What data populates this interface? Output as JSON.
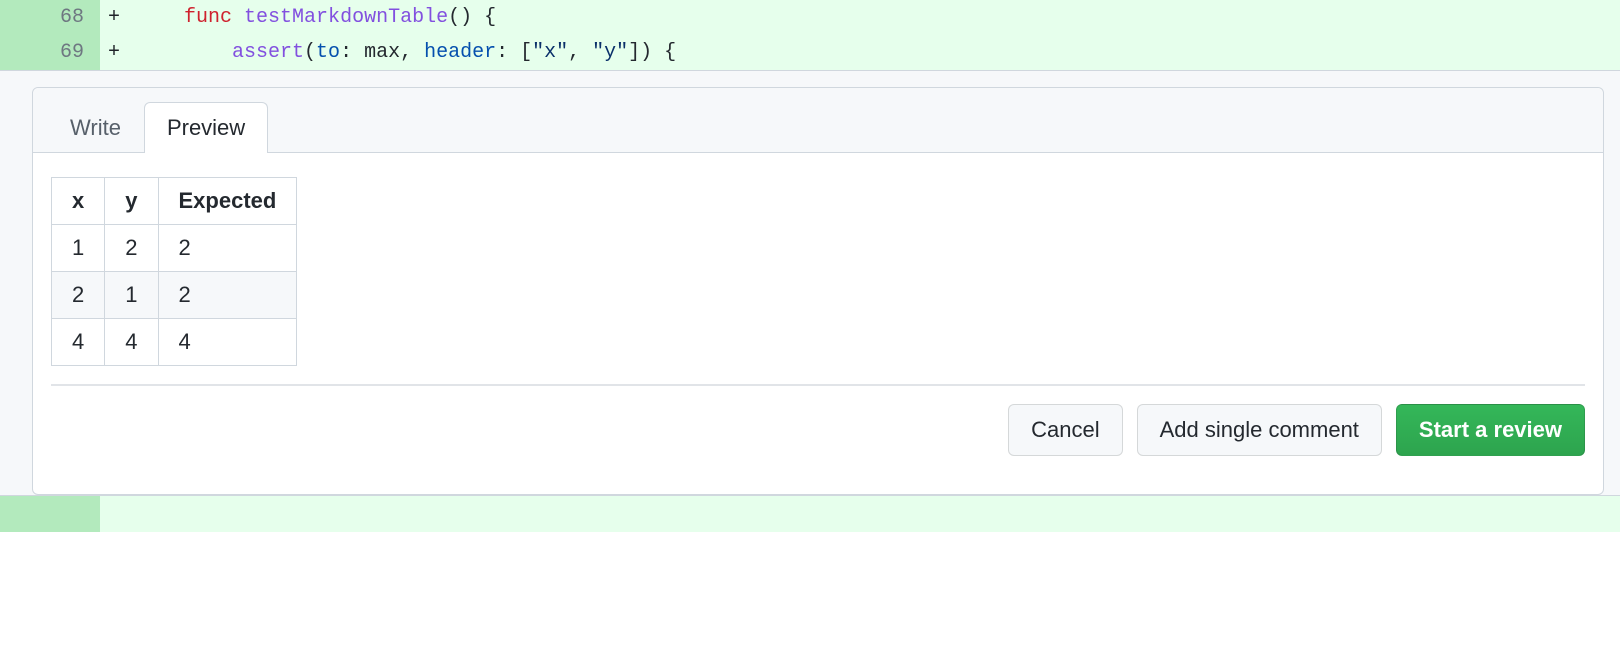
{
  "diff": {
    "lines": [
      {
        "num": "68",
        "marker": "+",
        "segments": [
          {
            "cls": "plain",
            "text": "    "
          },
          {
            "cls": "kw-func",
            "text": "func"
          },
          {
            "cls": "plain",
            "text": " "
          },
          {
            "cls": "kw-name",
            "text": "testMarkdownTable"
          },
          {
            "cls": "plain",
            "text": "() {"
          }
        ]
      },
      {
        "num": "69",
        "marker": "+",
        "segments": [
          {
            "cls": "plain",
            "text": "        "
          },
          {
            "cls": "kw-call",
            "text": "assert"
          },
          {
            "cls": "plain",
            "text": "("
          },
          {
            "cls": "kw-param",
            "text": "to"
          },
          {
            "cls": "plain",
            "text": ": max, "
          },
          {
            "cls": "kw-param",
            "text": "header"
          },
          {
            "cls": "plain",
            "text": ": ["
          },
          {
            "cls": "kw-string",
            "text": "\"x\""
          },
          {
            "cls": "plain",
            "text": ", "
          },
          {
            "cls": "kw-string",
            "text": "\"y\""
          },
          {
            "cls": "plain",
            "text": "]) {"
          }
        ]
      }
    ]
  },
  "tabs": {
    "write": "Write",
    "preview": "Preview"
  },
  "table": {
    "headers": [
      "x",
      "y",
      "Expected"
    ],
    "rows": [
      [
        "1",
        "2",
        "2"
      ],
      [
        "2",
        "1",
        "2"
      ],
      [
        "4",
        "4",
        "4"
      ]
    ]
  },
  "actions": {
    "cancel": "Cancel",
    "addSingle": "Add single comment",
    "startReview": "Start a review"
  }
}
